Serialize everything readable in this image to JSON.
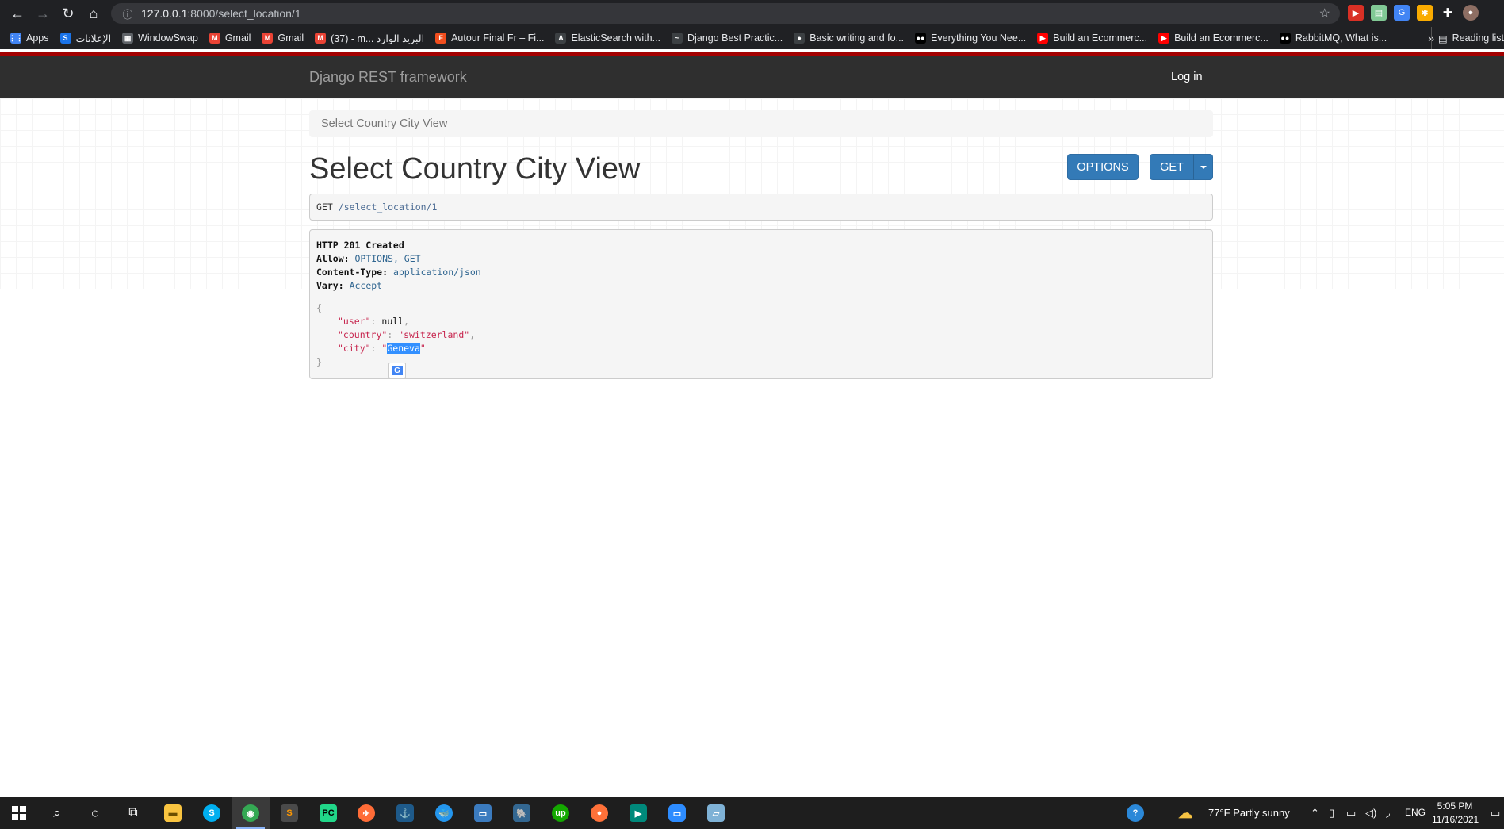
{
  "browser": {
    "url_host": "127.0.0.1",
    "url_rest": ":8000/select_location/1",
    "bookmarks": [
      {
        "label": "Apps",
        "color": "#4285f4",
        "glyph": "⋮⋮"
      },
      {
        "label": "الإعلانات",
        "color": "#1a73e8",
        "glyph": "S"
      },
      {
        "label": "WindowSwap",
        "color": "#5f6368",
        "glyph": "▦"
      },
      {
        "label": "Gmail",
        "color": "#ea4335",
        "glyph": "M"
      },
      {
        "label": "Gmail",
        "color": "#ea4335",
        "glyph": "M"
      },
      {
        "label": "(37) - m... البريد الوارد",
        "color": "#ea4335",
        "glyph": "M"
      },
      {
        "label": "Autour Final Fr – Fi...",
        "color": "#f24e1e",
        "glyph": "F"
      },
      {
        "label": "ElasticSearch with...",
        "color": "#3c4043",
        "glyph": "A"
      },
      {
        "label": "Django Best Practic...",
        "color": "#3c4043",
        "glyph": "~"
      },
      {
        "label": "Basic writing and fo...",
        "color": "#3c4043",
        "glyph": "●"
      },
      {
        "label": "Everything You Nee...",
        "color": "#000000",
        "glyph": "●●"
      },
      {
        "label": "Build an Ecommerc...",
        "color": "#ff0000",
        "glyph": "▶"
      },
      {
        "label": "Build an Ecommerc...",
        "color": "#ff0000",
        "glyph": "▶"
      },
      {
        "label": "RabbitMQ, What is...",
        "color": "#000000",
        "glyph": "●●"
      }
    ],
    "more_label": "»",
    "reading_list_label": "Reading list"
  },
  "drf": {
    "brand": "Django REST framework",
    "login": "Log in",
    "breadcrumb": "Select Country City View",
    "title": "Select Country City View",
    "options_label": "OPTIONS",
    "get_label": "GET",
    "request": {
      "method": "GET",
      "path": "/select_location/1"
    },
    "response": {
      "status": "HTTP 201 Created",
      "allow_key": "Allow:",
      "allow_val": "OPTIONS, GET",
      "ctype_key": "Content-Type:",
      "ctype_val": "application/json",
      "vary_key": "Vary:",
      "vary_val": "Accept",
      "open_brace": "{",
      "close_brace": "}",
      "user_key": "\"user\"",
      "user_val": "null",
      "country_key": "\"country\"",
      "country_val": "\"switzerland\"",
      "city_key": "\"city\"",
      "city_val": "Geneva"
    }
  },
  "taskbar": {
    "weather": "77°F  Partly sunny",
    "lang": "ENG",
    "time": "5:05 PM",
    "date": "11/16/2021"
  }
}
